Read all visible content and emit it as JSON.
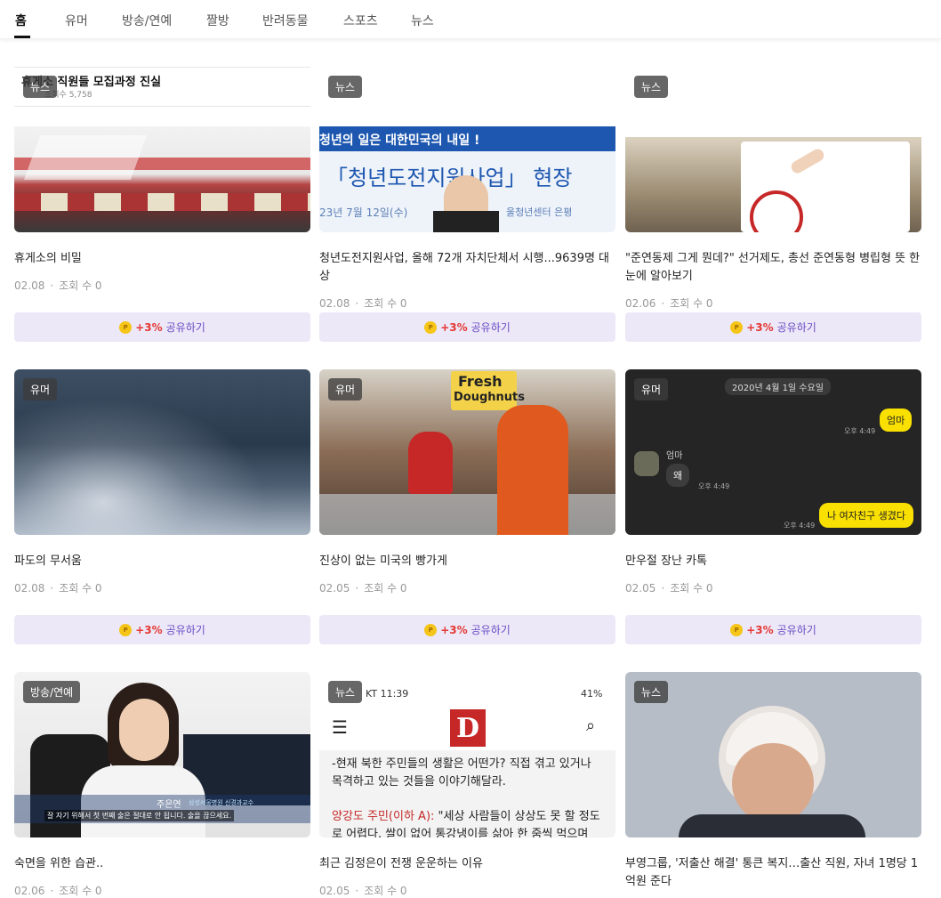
{
  "tabs": [
    {
      "label": "홈",
      "active": true
    },
    {
      "label": "유머",
      "active": false
    },
    {
      "label": "방송/연예",
      "active": false
    },
    {
      "label": "짤방",
      "active": false
    },
    {
      "label": "반려동물",
      "active": false
    },
    {
      "label": "스포츠",
      "active": false
    },
    {
      "label": "뉴스",
      "active": false
    }
  ],
  "share": {
    "icon": "coin-icon",
    "coin_letter": "P",
    "pct": "+3%",
    "label": "공유하기"
  },
  "cards": [
    {
      "badge": "뉴스",
      "title": "휴게소의 비밀",
      "date": "02.08",
      "views": "조회 수 0",
      "overlay_title": "휴게소 직원들 모집과정 진실",
      "overlay_views": "조회수 5,758"
    },
    {
      "badge": "뉴스",
      "title": "청년도전지원사업, 올해 72개 자치단체서 시행...9639명 대상",
      "date": "02.08",
      "views": "조회 수 0",
      "thumb_line1": "청년의 일은 대한민국의 내일 !",
      "thumb_line2": "「청년도전지원사업」 현장",
      "thumb_line3": "23년 7월 12일(수)",
      "thumb_line4": "울청년센터 은평"
    },
    {
      "badge": "뉴스",
      "title": "\"준연동제 그게 뭔데?\" 선거제도, 총선 준연동형 병립형 뜻 한눈에 알아보기",
      "date": "02.06",
      "views": "조회 수 0"
    },
    {
      "badge": "유머",
      "title": "파도의 무서움",
      "date": "02.08",
      "views": "조회 수 0"
    },
    {
      "badge": "유머",
      "title": "진상이 없는 미국의 빵가게",
      "date": "02.05",
      "views": "조회 수 0",
      "sign_line1": "Fresh",
      "sign_line2": "Doughnuts"
    },
    {
      "badge": "유머",
      "title": "만우절 장난 카톡",
      "date": "02.05",
      "views": "조회 수 0",
      "chat_date": "2020년 4월 1일 수요일",
      "msg1": "엄마",
      "time1": "오후 4:49",
      "sender": "엄마",
      "msg2": "왜",
      "time2": "오후 4:49",
      "msg3": "나 여자친구 생겼다",
      "time3": "오후 4:49"
    },
    {
      "badge": "방송/연예",
      "title": "숙면을 위한 습관..",
      "date": "02.06",
      "views": "조회 수 0",
      "caption_name": "주은연",
      "caption_role": "삼성서울병원 신경과교수",
      "subtitle": "잘 자기 위해서 첫 번째 술은 절대로 안 됩니다. 술을 끊으세요."
    },
    {
      "badge": "뉴스",
      "title": "최근 김정은이 전쟁 운운하는 이유",
      "date": "02.05",
      "views": "조회 수 0",
      "status_time": "KT 11:39",
      "battery": "41%",
      "logo": "D",
      "body1": "-현재 북한 주민들의 생활은 어떤가? 직접 겪고 있거나",
      "body2": "목격하고 있는 것들을 이야기해달라.",
      "body3_speaker": "양강도 주민(이하 A):",
      "body3": " \"세상 사람들이 상상도 못 할 정도",
      "body4": "로 어렵다. 쌀이 없어 통강냉이를 삶아 한 줌씩 먹으며"
    },
    {
      "badge": "뉴스",
      "title": "부영그룹, '저출산 해결' 통큰 복지…출산 직원, 자녀 1명당 1억원 준다",
      "date": "",
      "views": ""
    }
  ],
  "colors": {
    "share_bg": "#ece8f8",
    "share_text": "#6a4bc2",
    "pct": "#e53935",
    "coin": "#f5c518"
  }
}
